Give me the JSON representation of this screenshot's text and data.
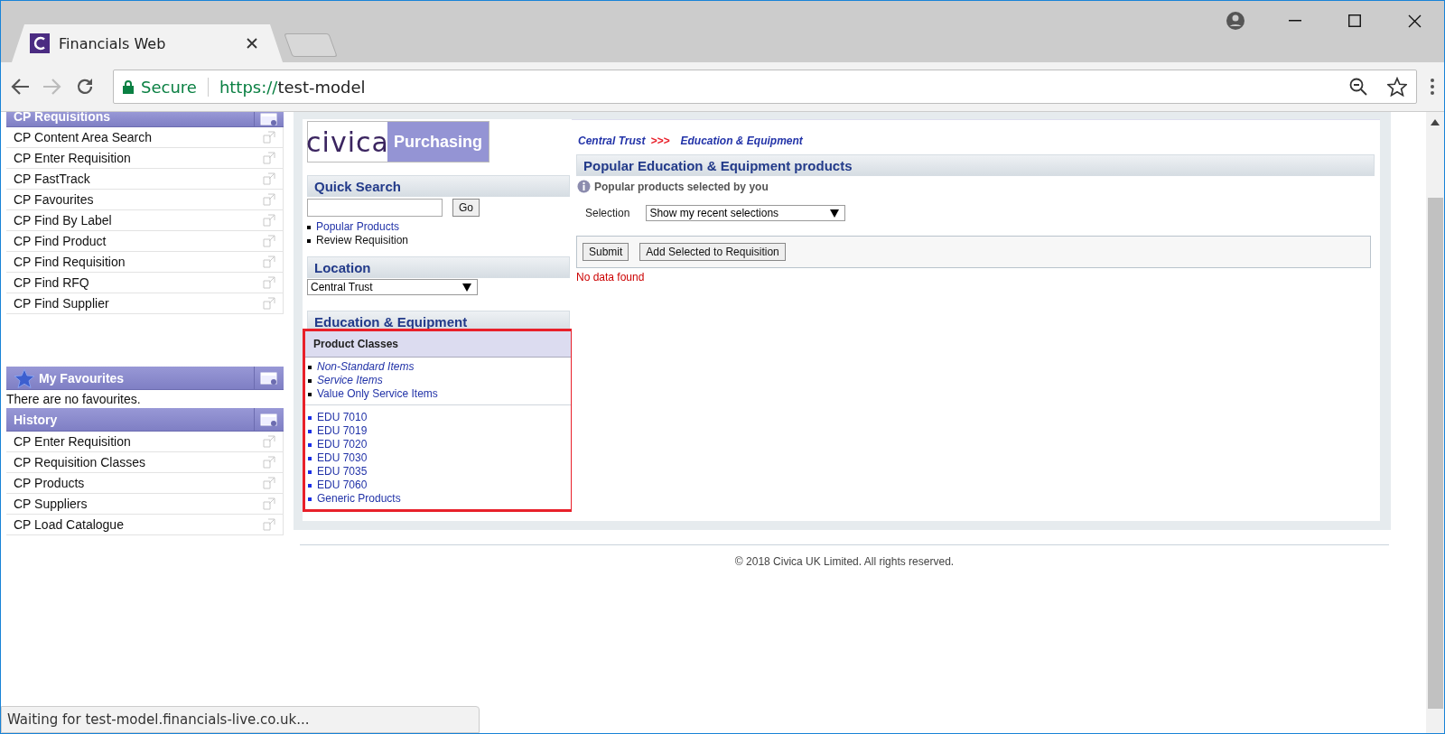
{
  "browser": {
    "tab_title": "Financials Web",
    "secure_label": "Secure",
    "url_scheme": "https://",
    "url_host": "test-model",
    "status_text": "Waiting for test-model.financials-live.co.uk..."
  },
  "sidebar": [
    {
      "kind": "list",
      "title": "CP Requisitions",
      "items": [
        "CP Content Area Search",
        "CP Enter Requisition",
        "CP FastTrack",
        "CP Favourites",
        "CP Find By Label",
        "CP Find Product",
        "CP Find Requisition",
        "CP Find RFQ",
        "CP Find Supplier"
      ]
    },
    {
      "kind": "empty",
      "title": "My Favourites",
      "message": "There are no favourites."
    },
    {
      "kind": "list",
      "title": "History",
      "items": [
        "CP Enter Requisition",
        "CP Requisition Classes",
        "CP Products",
        "CP Suppliers",
        "CP Load Catalogue"
      ]
    }
  ],
  "logo": {
    "brand": "civica",
    "product": "Purchasing"
  },
  "quick_search": {
    "title": "Quick Search",
    "button": "Go",
    "links": [
      {
        "label": "Popular Products",
        "kind": "link"
      },
      {
        "label": "Review Requisition",
        "kind": "plain"
      }
    ]
  },
  "location": {
    "title": "Location",
    "value": "Central Trust"
  },
  "category": {
    "title": "Education & Equipment",
    "classes_title": "Product Classes",
    "highlighted": true,
    "special_items": [
      {
        "label": "Non-Standard Items",
        "italic": true
      },
      {
        "label": "Service Items",
        "italic": true
      },
      {
        "label": "Value Only Service Items",
        "italic": false
      }
    ],
    "classes": [
      "EDU 7010",
      "EDU 7019",
      "EDU 7020",
      "EDU 7030",
      "EDU 7035",
      "EDU 7060",
      "Generic Products"
    ]
  },
  "content": {
    "breadcrumb": [
      "Central Trust",
      ">>>",
      "Education & Equipment"
    ],
    "section_title": "Popular Education & Equipment products",
    "info": "Popular products selected by you",
    "selection_label": "Selection",
    "selection_value": "Show my recent selections",
    "buttons": [
      "Submit",
      "Add Selected to Requisition"
    ],
    "message": "No data found"
  },
  "footer": "© 2018 Civica UK Limited. All rights reserved."
}
